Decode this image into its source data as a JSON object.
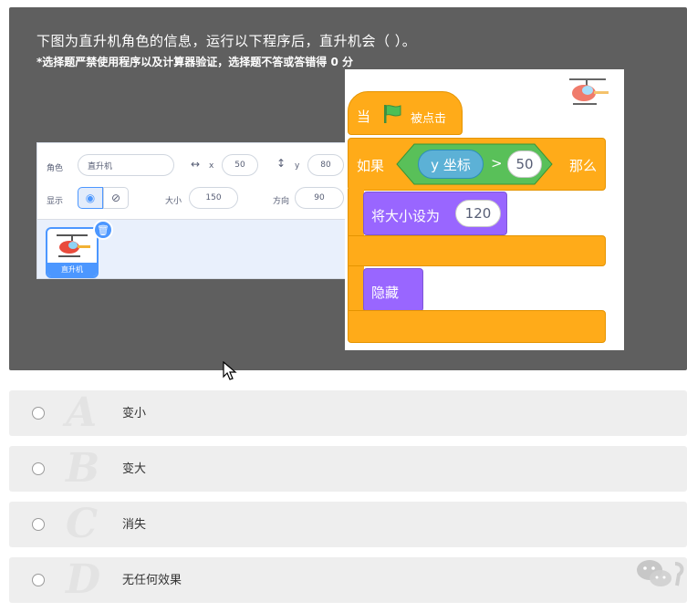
{
  "question": {
    "text": "下图为直升机角色的信息，运行以下程序后，直升机会（ ）。",
    "note": "*选择题严禁使用程序以及计算器验证，选择题不答或答错得 0 分"
  },
  "sprite_info": {
    "sprite_label": "角色",
    "sprite_name": "直升机",
    "x_label": "x",
    "x_value": "50",
    "y_label": "y",
    "y_value": "80",
    "show_label": "显示",
    "size_label": "大小",
    "size_value": "150",
    "direction_label": "方向",
    "direction_value": "90",
    "thumb_label": "直升机"
  },
  "code": {
    "hat_text": "当",
    "hat_suffix": "被点击",
    "if_text": "如果",
    "reporter": "y 坐标",
    "operator": ">",
    "compare_value": "50",
    "then_text": "那么",
    "set_size_text": "将大小设为",
    "set_size_value": "120",
    "hide_text": "隐藏"
  },
  "options": [
    {
      "letter": "A",
      "text": "变小"
    },
    {
      "letter": "B",
      "text": "变大"
    },
    {
      "letter": "C",
      "text": "消失"
    },
    {
      "letter": "D",
      "text": "无任何效果"
    }
  ],
  "colors": {
    "events": "#ffab19",
    "looks": "#9966ff",
    "motion_reporter": "#5cb1d6",
    "flag": "#4cbf56"
  }
}
